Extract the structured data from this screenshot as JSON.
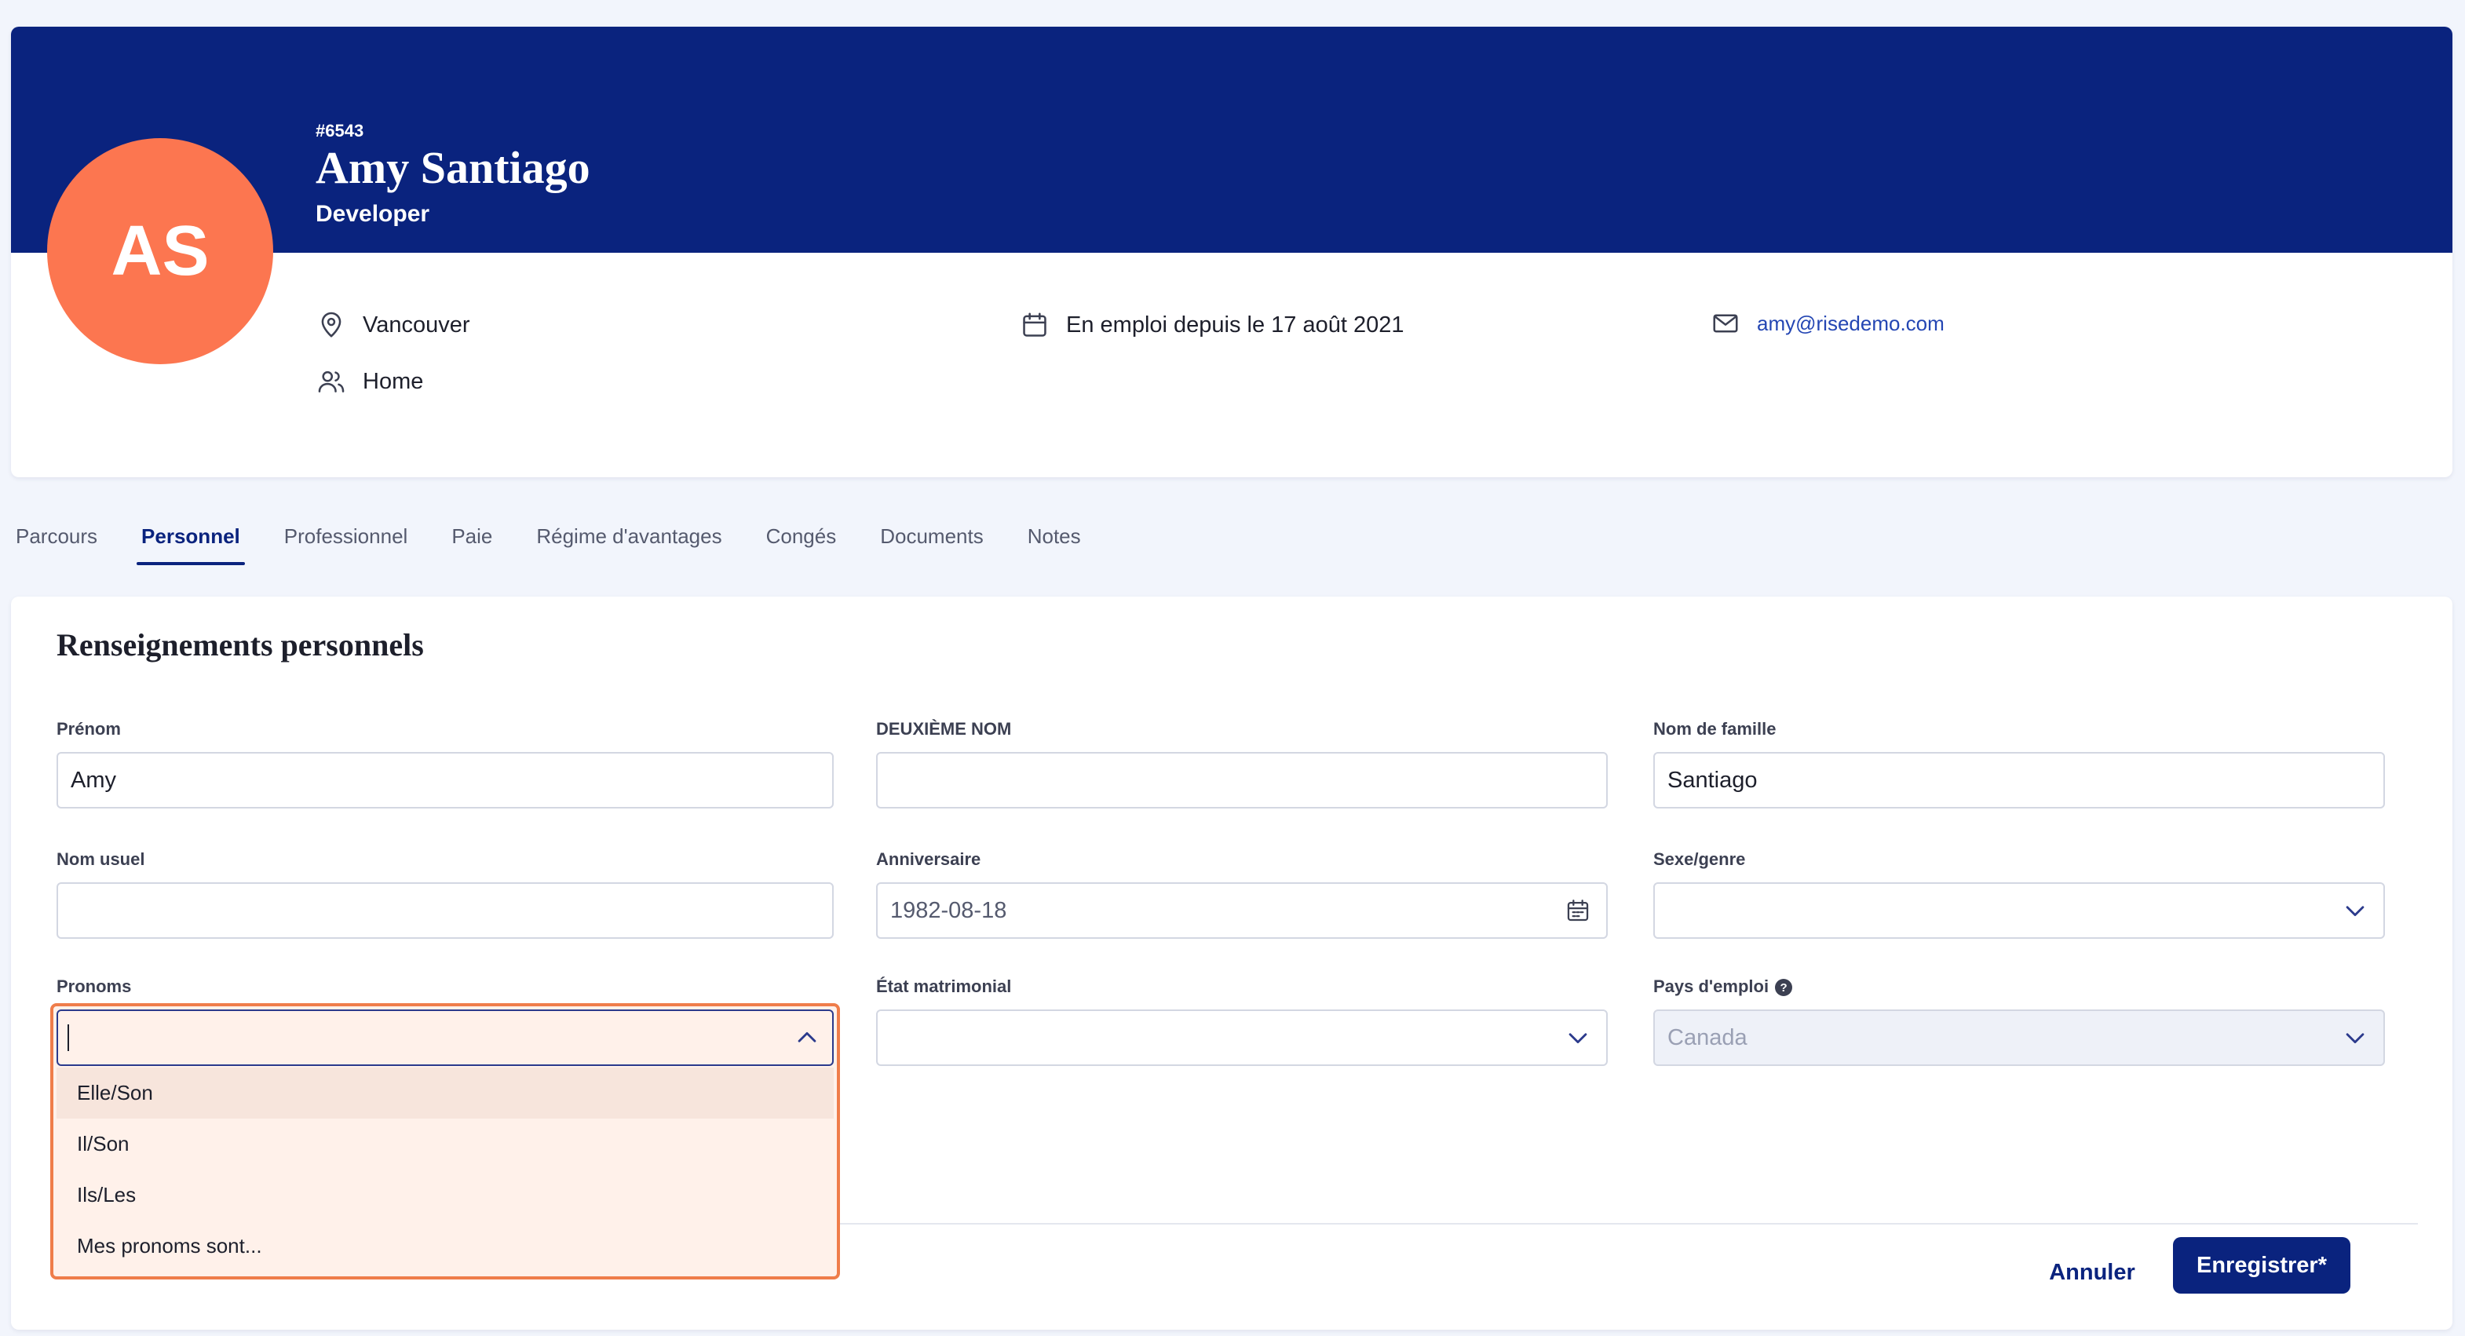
{
  "profile": {
    "initials": "AS",
    "employee_id": "#6543",
    "name": "Amy Santiago",
    "role": "Developer",
    "location": "Vancouver",
    "team": "Home",
    "employment": "En emploi depuis le 17 août 2021",
    "email": "amy@risedemo.com",
    "avatar_color": "#fc7650",
    "banner_color": "#0a237e"
  },
  "tabs": [
    {
      "label": "Parcours"
    },
    {
      "label": "Personnel"
    },
    {
      "label": "Professionnel"
    },
    {
      "label": "Paie"
    },
    {
      "label": "Régime d'avantages"
    },
    {
      "label": "Congés"
    },
    {
      "label": "Documents"
    },
    {
      "label": "Notes"
    }
  ],
  "active_tab": "Personnel",
  "form": {
    "title": "Renseignements personnels",
    "first_name": {
      "label": "Prénom",
      "value": "Amy"
    },
    "middle_name": {
      "label": "DEUXIÈME NOM",
      "value": ""
    },
    "last_name": {
      "label": "Nom de famille",
      "value": "Santiago"
    },
    "preferred_name": {
      "label": "Nom usuel",
      "value": ""
    },
    "birthday": {
      "label": "Anniversaire",
      "value": "1982-08-18"
    },
    "gender": {
      "label": "Sexe/genre",
      "value": ""
    },
    "pronouns": {
      "label": "Pronoms",
      "value": "",
      "options": [
        "Elle/Son",
        "Il/Son",
        "Ils/Les",
        "Mes pronoms sont..."
      ]
    },
    "marital_status": {
      "label": "État matrimonial",
      "value": ""
    },
    "country": {
      "label": "Pays d'emploi",
      "value": "Canada"
    }
  },
  "actions": {
    "cancel_label": "Annuler",
    "save_label": "Enregistrer*"
  },
  "colors": {
    "accent": "#0a237e",
    "focus_outline": "#ef7d4a",
    "dropdown_bg": "#fff1ea"
  }
}
